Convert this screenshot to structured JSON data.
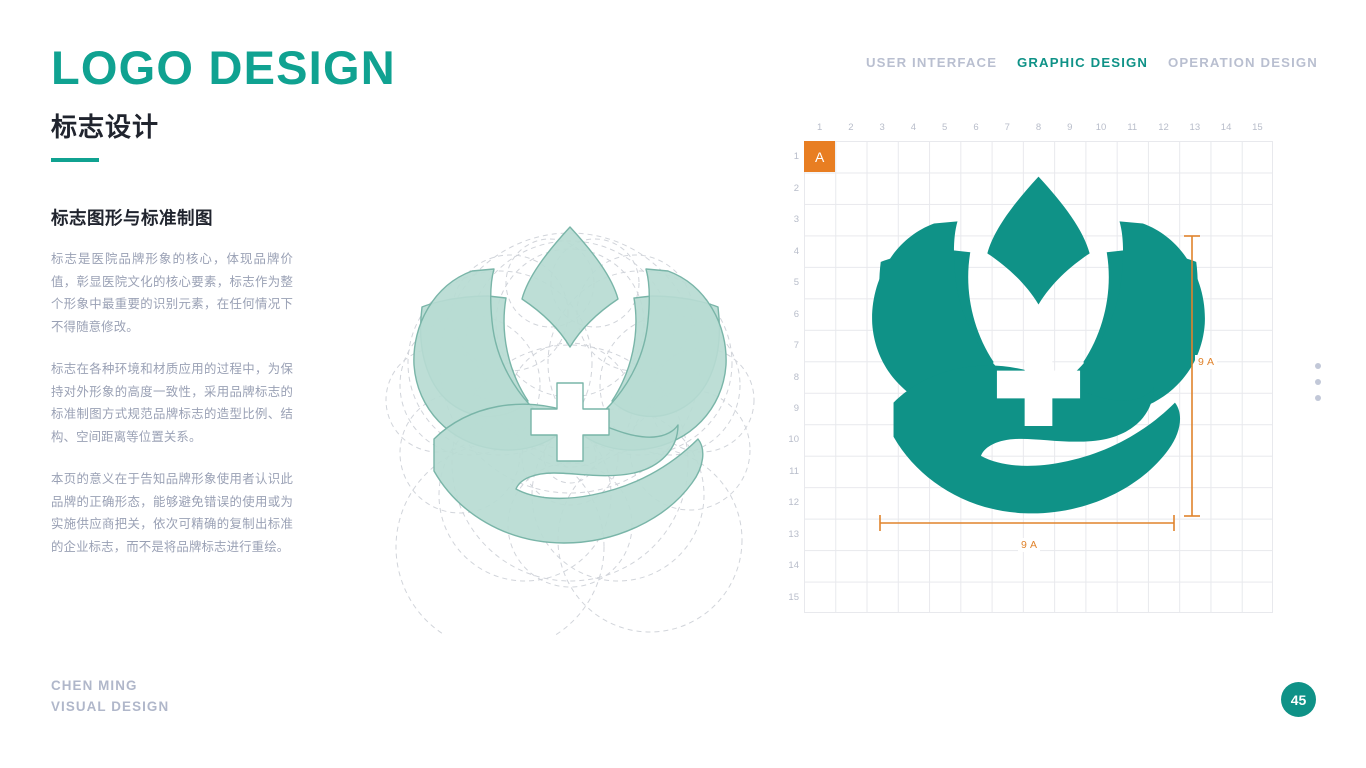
{
  "nav": {
    "items": [
      {
        "label": "USER INTERFACE",
        "active": false
      },
      {
        "label": "GRAPHIC DESIGN",
        "active": true
      },
      {
        "label": "OPERATION DESIGN",
        "active": false
      }
    ]
  },
  "header": {
    "title_en": "LOGO DESIGN",
    "title_cn": "标志设计"
  },
  "content": {
    "subheading": "标志图形与标准制图",
    "paragraphs": [
      "标志是医院品牌形象的核心，体现品牌价值，彰显医院文化的核心要素，标志作为整个形象中最重要的识别元素，在任何情况下不得随意修改。",
      "标志在各种环境和材质应用的过程中，为保持对外形象的高度一致性，采用品牌标志的标准制图方式规范品牌标志的造型比例、结构、空间距离等位置关系。",
      "本页的意义在于告知品牌形象使用者认识此品牌的正确形态，能够避免错误的使用或为实施供应商把关，依次可精确的复制出标准的企业标志，而不是将品牌标志进行重绘。"
    ]
  },
  "footer": {
    "signature_line1": "CHEN MING",
    "signature_line2": "VISUAL DESIGN",
    "page_number": "45"
  },
  "grid": {
    "unit_cell_label": "A",
    "column_labels": [
      "1",
      "2",
      "3",
      "4",
      "5",
      "6",
      "7",
      "8",
      "9",
      "10",
      "11",
      "12",
      "13",
      "14",
      "15"
    ],
    "row_labels": [
      "1",
      "2",
      "3",
      "4",
      "5",
      "6",
      "7",
      "8",
      "9",
      "10",
      "11",
      "12",
      "13",
      "14",
      "15"
    ],
    "dimension_vertical": "9 A",
    "dimension_horizontal": "9 A"
  },
  "colors": {
    "brand_teal": "#0f9287",
    "title_teal": "#10a291",
    "accent_orange": "#e87e22",
    "dimension_orange": "#e0832c",
    "logo_light_fill": "#b7dbd2",
    "logo_light_stroke": "#79b5a8",
    "guide_gray": "#c9cdd4",
    "body_text": "#9aa1b5",
    "heading_dark": "#20242e",
    "nav_muted": "#b9bfd0",
    "grid_line": "#e8e9ed"
  },
  "icons": {
    "logo": "lotus-hand-medical-cross-logo",
    "side_dots": "pagination-dots-icon"
  }
}
